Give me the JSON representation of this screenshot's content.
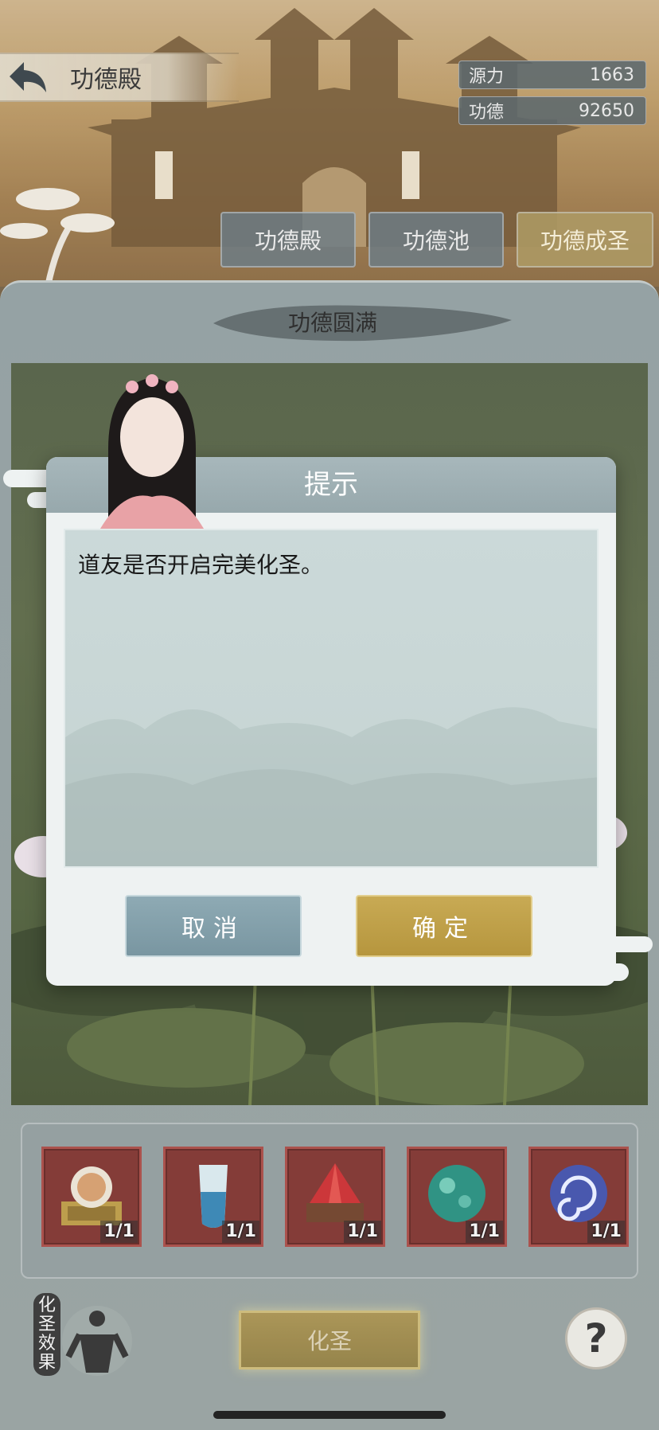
{
  "header": {
    "title": "功德殿",
    "resources": [
      {
        "label": "源力",
        "value": "1663"
      },
      {
        "label": "功德",
        "value": "92650"
      }
    ]
  },
  "tabs": [
    {
      "label": "功德殿"
    },
    {
      "label": "功德池"
    },
    {
      "label": "功德成圣"
    }
  ],
  "panel": {
    "title": "功德圆满"
  },
  "dialog": {
    "title": "提示",
    "message": "道友是否开启完美化圣。",
    "cancel_label": "取消",
    "confirm_label": "确定"
  },
  "items": [
    {
      "icon": "seal-icon",
      "count": "1/1"
    },
    {
      "icon": "potion-icon",
      "count": "1/1"
    },
    {
      "icon": "red-crystal-icon",
      "count": "1/1"
    },
    {
      "icon": "jade-orb-icon",
      "count": "1/1"
    },
    {
      "icon": "vortex-orb-icon",
      "count": "1/1"
    }
  ],
  "bottom": {
    "effect_label": "化圣效果",
    "transform_label": "化圣",
    "help_label": "?"
  },
  "colors": {
    "dialog_header": "#a7b7bb",
    "cancel_button": "#7996a1",
    "confirm_button": "#b6963e",
    "item_slot": "#7a2c28",
    "transform_button": "#9a8444"
  }
}
